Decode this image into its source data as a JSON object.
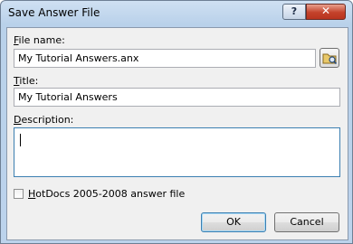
{
  "window": {
    "title": "Save Answer File",
    "help_glyph": "?",
    "close_glyph": "✕"
  },
  "form": {
    "file_name": {
      "label_accel": "F",
      "label_rest": "ile name:",
      "value": "My Tutorial Answers.anx"
    },
    "title": {
      "label_accel": "T",
      "label_rest": "itle:",
      "value": "My Tutorial Answers"
    },
    "description": {
      "label_accel": "D",
      "label_rest": "escription:",
      "value": ""
    },
    "hotdocs_checkbox": {
      "label_accel": "H",
      "label_rest": "otDocs 2005-2008 answer file",
      "checked": false
    }
  },
  "buttons": {
    "ok": "OK",
    "cancel": "Cancel"
  },
  "icons": {
    "browse": "browse-folder-icon",
    "help": "help-icon",
    "close": "close-icon"
  },
  "colors": {
    "title_bar": "#b9d1ea",
    "close_button": "#c4422b",
    "focus_border": "#3c7fb1"
  }
}
